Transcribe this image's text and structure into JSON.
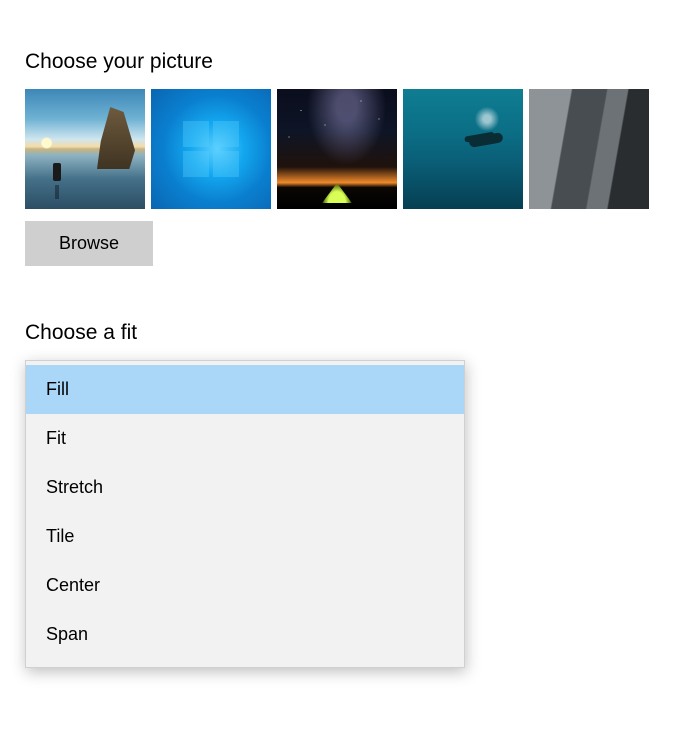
{
  "picture": {
    "heading": "Choose your picture",
    "thumbnails": [
      {
        "name": "beach-sunrise"
      },
      {
        "name": "windows-light-blue"
      },
      {
        "name": "milky-way-tent"
      },
      {
        "name": "underwater-diver"
      },
      {
        "name": "rock-cliff"
      }
    ],
    "browse_label": "Browse"
  },
  "fit": {
    "heading": "Choose a fit",
    "selected": "Fill",
    "options": [
      "Fill",
      "Fit",
      "Stretch",
      "Tile",
      "Center",
      "Span"
    ]
  }
}
